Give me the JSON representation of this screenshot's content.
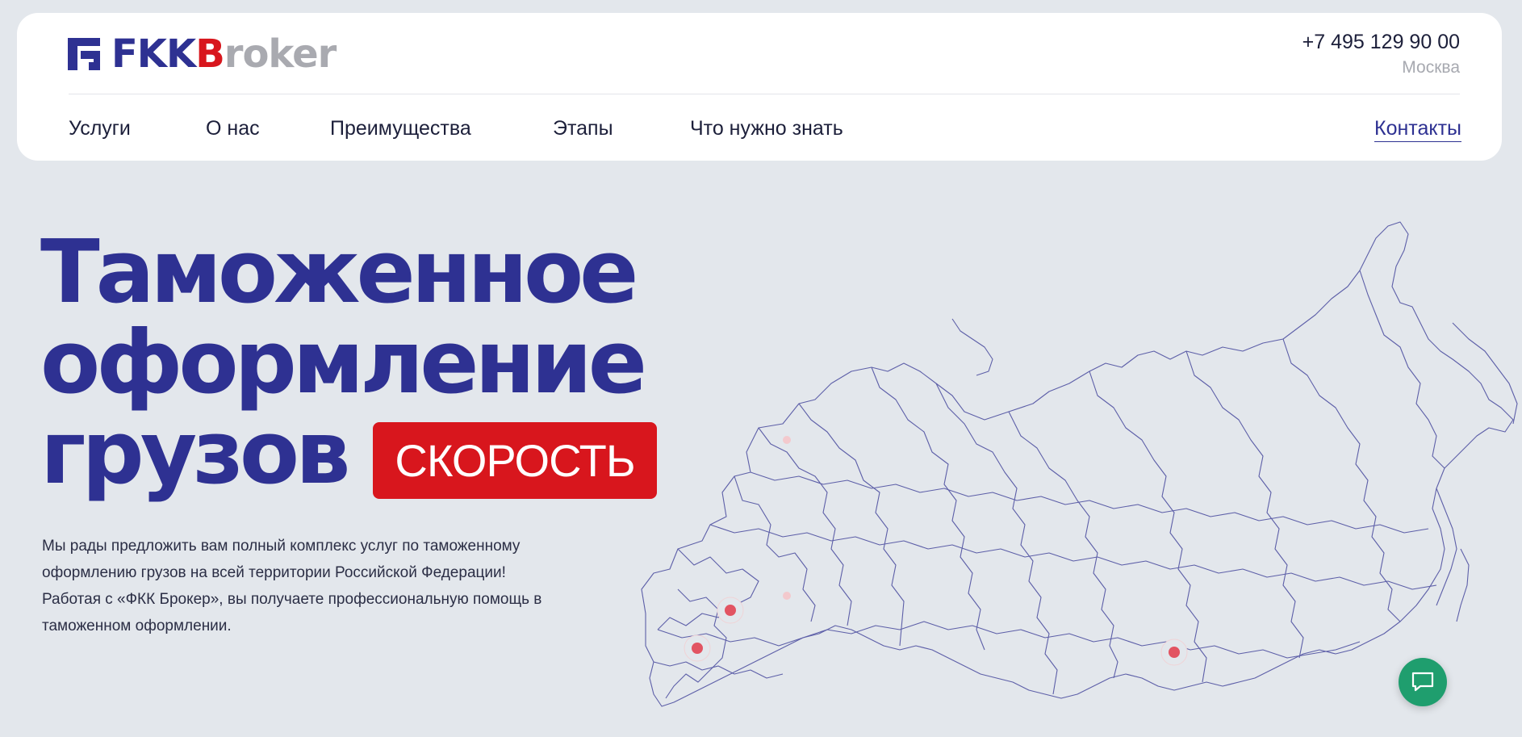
{
  "brand": {
    "logo_part1": "FKK",
    "logo_part2": "B",
    "logo_part3": "roker",
    "colors": {
      "primary": "#2e3192",
      "accent": "#d8161d",
      "muted": "#a9aab0",
      "chat": "#1f9e6e"
    }
  },
  "contact": {
    "phone": "+7 495 129 90 00",
    "city": "Москва"
  },
  "nav": {
    "items": [
      "Услуги",
      "О нас",
      "Преимущества",
      "Этапы",
      "Что нужно знать"
    ],
    "contacts_label": "Контакты"
  },
  "hero": {
    "title_line1": "Таможенное",
    "title_line2": "оформление",
    "title_line3": "грузов",
    "badge": "СКОРОСТЬ",
    "intro": "Мы рады предложить вам полный комплекс услуг по таможенному оформлению грузов на всей территории Российской Федерации! Работая с «ФКК Брокер», вы получаете профессиональную помощь в таможенном оформлении."
  },
  "icons": {
    "logo": "logo-mark-icon",
    "map": "russia-map-icon",
    "chat": "chat-bubble-icon"
  }
}
